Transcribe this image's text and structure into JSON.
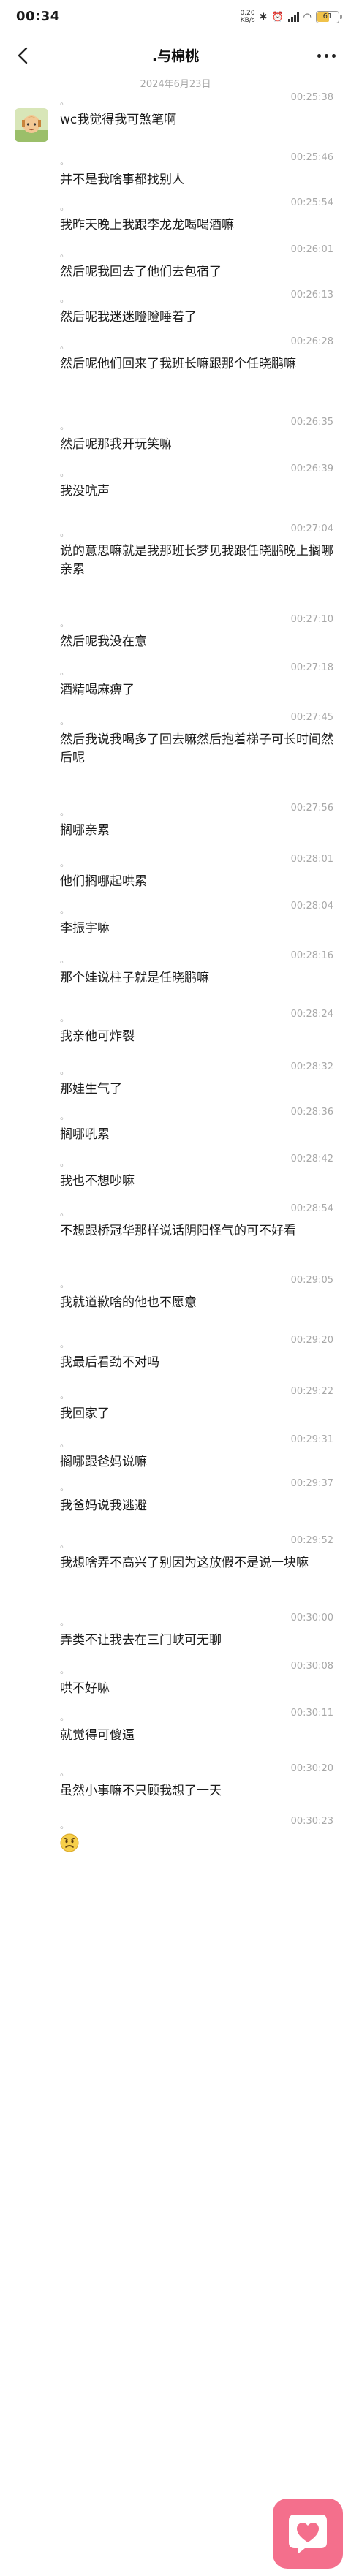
{
  "status_bar": {
    "time": "00:34",
    "net_speed": "0.20",
    "net_unit": "KB/s",
    "battery": "61",
    "battery_level": 0.61,
    "battery_color": "#f0c24a"
  },
  "header": {
    "title": ".与棉桃",
    "back_icon": "back-arrow-icon",
    "more_icon": "more-dots-icon"
  },
  "date_divider": "2024年6月23日",
  "sender_mark": "。",
  "messages": [
    {
      "time": "00:25:38",
      "text": "wc我觉得我可煞笔啊"
    },
    {
      "time": "00:25:46",
      "text": "并不是我啥事都找别人"
    },
    {
      "time": "00:25:54",
      "text": "我昨天晚上我跟李龙龙喝喝酒嘛"
    },
    {
      "time": "00:26:01",
      "text": "然后呢我回去了他们去包宿了"
    },
    {
      "time": "00:26:13",
      "text": "然后呢我迷迷瞪瞪睡着了"
    },
    {
      "time": "00:26:28",
      "text": "然后呢他们回来了我班长嘛跟那个任晓鹏嘛"
    },
    {
      "time": "00:26:35",
      "text": "然后呢那我开玩笑嘛"
    },
    {
      "time": "00:26:39",
      "text": "我没吭声"
    },
    {
      "time": "00:27:04",
      "text": "说的意思嘛就是我那班长梦见我跟任晓鹏晚上搁哪亲累"
    },
    {
      "time": "00:27:10",
      "text": "然后呢我没在意"
    },
    {
      "time": "00:27:18",
      "text": "酒精喝麻痹了"
    },
    {
      "time": "00:27:45",
      "text": "然后我说我喝多了回去嘛然后抱着梯子可长时间然后呢"
    },
    {
      "time": "00:27:56",
      "text": "搁哪亲累"
    },
    {
      "time": "00:28:01",
      "text": "他们搁哪起哄累"
    },
    {
      "time": "00:28:04",
      "text": "李振宇嘛"
    },
    {
      "time": "00:28:16",
      "text": "那个娃说柱子就是任晓鹏嘛"
    },
    {
      "time": "00:28:24",
      "text": "我亲他可炸裂"
    },
    {
      "time": "00:28:32",
      "text": "那娃生气了"
    },
    {
      "time": "00:28:36",
      "text": "搁哪吼累"
    },
    {
      "time": "00:28:42",
      "text": "我也不想吵嘛"
    },
    {
      "time": "00:28:54",
      "text": "不想跟桥冠华那样说话阴阳怪气的可不好看"
    },
    {
      "time": "00:29:05",
      "text": "我就道歉啥的他也不愿意"
    },
    {
      "time": "00:29:20",
      "text": "我最后看劲不对吗"
    },
    {
      "time": "00:29:22",
      "text": "我回家了"
    },
    {
      "time": "00:29:31",
      "text": "搁哪跟爸妈说嘛"
    },
    {
      "time": "00:29:37",
      "text": "我爸妈说我逃避"
    },
    {
      "time": "00:29:52",
      "text": "我想啥弄不高兴了别因为这放假不是说一块嘛"
    },
    {
      "time": "00:30:00",
      "text": "弄类不让我去在三门峡可无聊"
    },
    {
      "time": "00:30:08",
      "text": "哄不好嘛"
    },
    {
      "time": "00:30:11",
      "text": "就觉得可傻逼"
    },
    {
      "time": "00:30:20",
      "text": "虽然小事嘛不只顾我想了一天"
    },
    {
      "time": "00:30:23",
      "text": "",
      "emoji": "worried-face-emoji-icon"
    }
  ],
  "fab": {
    "icon": "heart-bubble-icon",
    "color": "#f46f8c"
  },
  "colors": {
    "text": "#1c1c1c",
    "meta": "#a8a8a8",
    "background": "#ffffff"
  }
}
